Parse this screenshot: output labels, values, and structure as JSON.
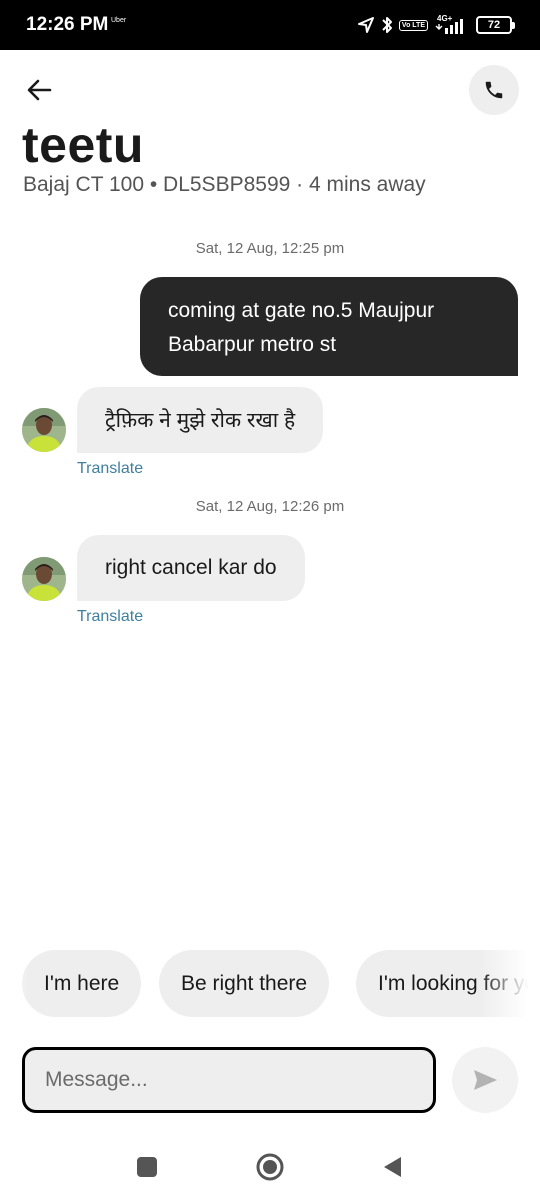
{
  "status_bar": {
    "time": "12:26 PM",
    "app_label": "Uber",
    "volte_label": "Vo LTE",
    "network_label": "4G+",
    "battery": "72"
  },
  "header": {
    "driver_name": "teetu",
    "vehicle_info": "Bajaj CT 100 • DL5SBP8599 · 4 mins away"
  },
  "messages": [
    {
      "type": "timestamp",
      "text": "Sat, 12 Aug, 12:25 pm"
    },
    {
      "type": "outgoing",
      "text": "coming at gate no.5 Maujpur Babarpur metro st"
    },
    {
      "type": "incoming",
      "text": "ट्रैफ़िक ने मुझे रोक रखा है",
      "translate_label": "Translate"
    },
    {
      "type": "timestamp",
      "text": "Sat, 12 Aug, 12:26 pm"
    },
    {
      "type": "incoming",
      "text": "right cancel kar do",
      "translate_label": "Translate"
    }
  ],
  "quick_replies": [
    "I'm here",
    "Be right there",
    "I'm looking for you"
  ],
  "composer": {
    "placeholder": "Message..."
  },
  "icons": {
    "back": "arrow-left-icon",
    "call": "phone-icon",
    "send": "send-icon",
    "nav_recents": "square-icon",
    "nav_home": "circle-icon",
    "nav_back": "triangle-icon"
  },
  "colors": {
    "outgoing_bubble": "#272727",
    "incoming_bubble": "#eeeeee",
    "translate_link": "#3f7f9f"
  }
}
